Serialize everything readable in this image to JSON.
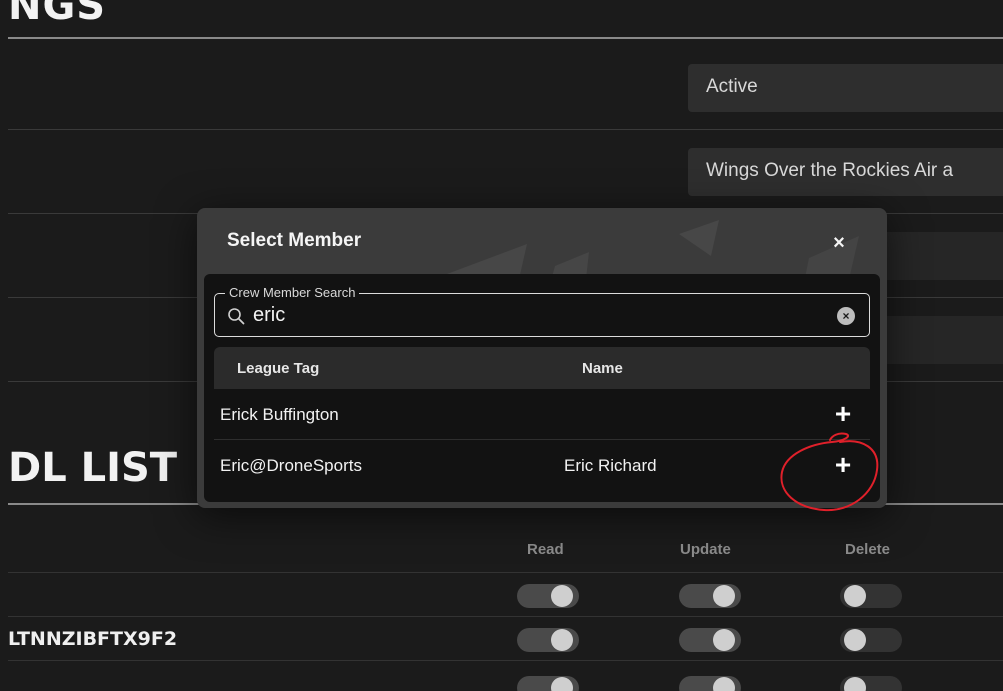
{
  "page": {
    "heading_top": "NGS",
    "fields": [
      "Active",
      "Wings Over the Rockies Air a"
    ],
    "heading_list": "DL LIST",
    "permission_headers": [
      "Read",
      "Update",
      "Delete"
    ],
    "row_tag": "LTNNZIBFTX9F2"
  },
  "modal": {
    "title": "Select Member",
    "close_label": "×",
    "search": {
      "legend": "Crew Member Search",
      "value": "eric"
    },
    "table": {
      "headers": [
        "League Tag",
        "Name"
      ],
      "rows": [
        {
          "league_tag": "Erick Buffington",
          "name": ""
        },
        {
          "league_tag": "Eric@DroneSports",
          "name": "Eric Richard"
        }
      ],
      "add_label": "+"
    }
  },
  "icons": {
    "search": "search-icon",
    "clear": "clear-circle-icon",
    "close": "close-icon",
    "add": "plus-icon"
  },
  "colors": {
    "background": "#1b1b1b",
    "modal": "#3b3b3b",
    "modal_body": "#121212",
    "annotation": "#e0202a"
  }
}
